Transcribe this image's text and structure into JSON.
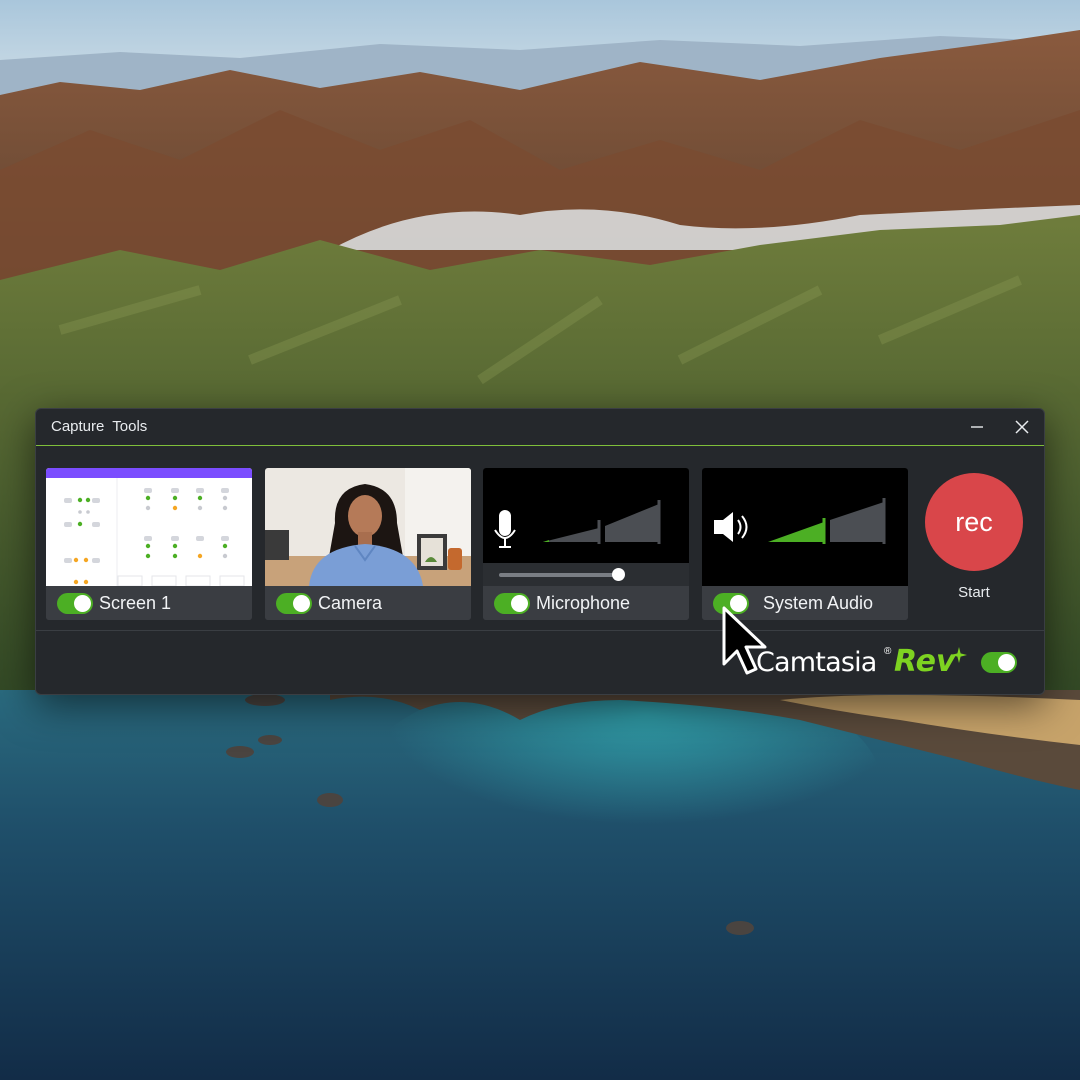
{
  "window": {
    "title": "Capture Tools"
  },
  "sources": [
    {
      "id": "screen",
      "label": "Screen 1",
      "enabled": true
    },
    {
      "id": "camera",
      "label": "Camera",
      "enabled": true
    },
    {
      "id": "microphone",
      "label": "Microphone",
      "enabled": true,
      "volume": 0.75
    },
    {
      "id": "system-audio",
      "label": "System Audio",
      "enabled": true
    }
  ],
  "record": {
    "button_label": "rec",
    "start_label": "Start"
  },
  "brand": {
    "name": "Camtasia",
    "registered": "®",
    "product": "Rev",
    "rev_enabled": true
  },
  "colors": {
    "accent_green": "#4caf24",
    "rev_green": "#7ed321",
    "rec_red": "#d9464a",
    "window_bg": "#25282c",
    "screen_preview_bar": "#7b4dff"
  },
  "icons": [
    "minimize-icon",
    "close-icon",
    "microphone-icon",
    "speaker-icon",
    "sparkle-icon",
    "mouse-pointer-icon"
  ]
}
